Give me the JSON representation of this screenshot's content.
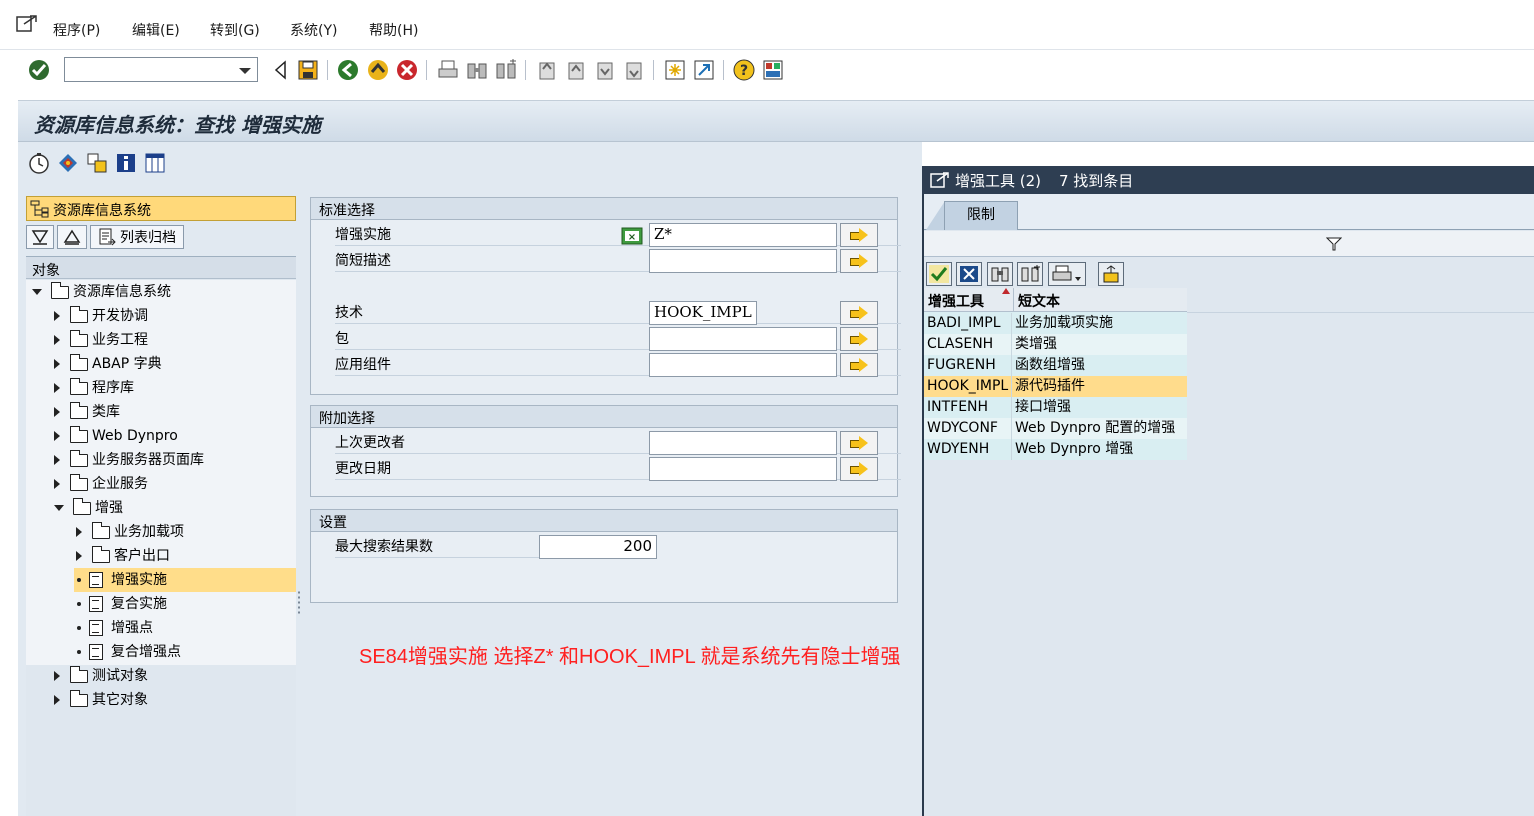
{
  "menu": {
    "items": [
      "程序(P)",
      "编辑(E)",
      "转到(G)",
      "系统(Y)",
      "帮助(H)"
    ]
  },
  "title": "资源库信息系统：查找 增强实施",
  "nav": {
    "header": "资源库信息系统",
    "list_archive_label": "列表归档",
    "objects_header": "对象",
    "tree": [
      {
        "label": "资源库信息系统",
        "level": 0,
        "state": "open"
      },
      {
        "label": "开发协调",
        "level": 1,
        "state": "closed"
      },
      {
        "label": "业务工程",
        "level": 1,
        "state": "closed"
      },
      {
        "label": "ABAP 字典",
        "level": 1,
        "state": "closed"
      },
      {
        "label": "程序库",
        "level": 1,
        "state": "closed"
      },
      {
        "label": "类库",
        "level": 1,
        "state": "closed"
      },
      {
        "label": "Web Dynpro",
        "level": 1,
        "state": "closed"
      },
      {
        "label": "业务服务器页面库",
        "level": 1,
        "state": "closed"
      },
      {
        "label": "企业服务",
        "level": 1,
        "state": "closed"
      },
      {
        "label": "增强",
        "level": 1,
        "state": "open"
      },
      {
        "label": "业务加载项",
        "level": 2,
        "state": "closed"
      },
      {
        "label": "客户出口",
        "level": 2,
        "state": "closed"
      },
      {
        "label": "增强实施",
        "level": 2,
        "state": "leaf",
        "selected": true
      },
      {
        "label": "复合实施",
        "level": 2,
        "state": "leaf"
      },
      {
        "label": "增强点",
        "level": 2,
        "state": "leaf"
      },
      {
        "label": "复合增强点",
        "level": 2,
        "state": "leaf"
      },
      {
        "label": "测试对象",
        "level": 1,
        "state": "closed"
      },
      {
        "label": "其它对象",
        "level": 1,
        "state": "closed"
      }
    ]
  },
  "standard_selection": {
    "title": "标准选择",
    "enh_impl_label": "增强实施",
    "enh_impl_value": "Z*",
    "short_desc_label": "简短描述",
    "short_desc_value": "",
    "tech_label": "技术",
    "tech_value": "HOOK_IMPL",
    "package_label": "包",
    "package_value": "",
    "app_comp_label": "应用组件",
    "app_comp_value": ""
  },
  "additional_selection": {
    "title": "附加选择",
    "last_changed_by_label": "上次更改者",
    "last_changed_by_value": "",
    "changed_on_label": "更改日期",
    "changed_on_value": ""
  },
  "settings": {
    "title": "设置",
    "max_hits_label": "最大搜索结果数",
    "max_hits_value": "200"
  },
  "annotation": "SE84增强实施  选择Z* 和HOOK_IMPL 就是系统先有隐士增强",
  "popup": {
    "title": "增强工具 (2)",
    "found": "7 找到条目",
    "tab_limit": "限制",
    "col_tool": "增强工具",
    "col_text": "短文本",
    "rows": [
      {
        "tool": "BADI_IMPL",
        "text": "业务加载项实施"
      },
      {
        "tool": "CLASENH",
        "text": "类增强"
      },
      {
        "tool": "FUGRENH",
        "text": "函数组增强"
      },
      {
        "tool": "HOOK_IMPL",
        "text": "源代码插件",
        "selected": true
      },
      {
        "tool": "INTFENH",
        "text": "接口增强"
      },
      {
        "tool": "WDYCONF",
        "text": "Web Dynpro 配置的增强"
      },
      {
        "tool": "WDYENH",
        "text": "Web Dynpro 增强"
      }
    ]
  },
  "colors": {
    "selection": "#ffdd8a",
    "popup_title_bg": "#2e3e52",
    "annotation": "#ff2020"
  }
}
